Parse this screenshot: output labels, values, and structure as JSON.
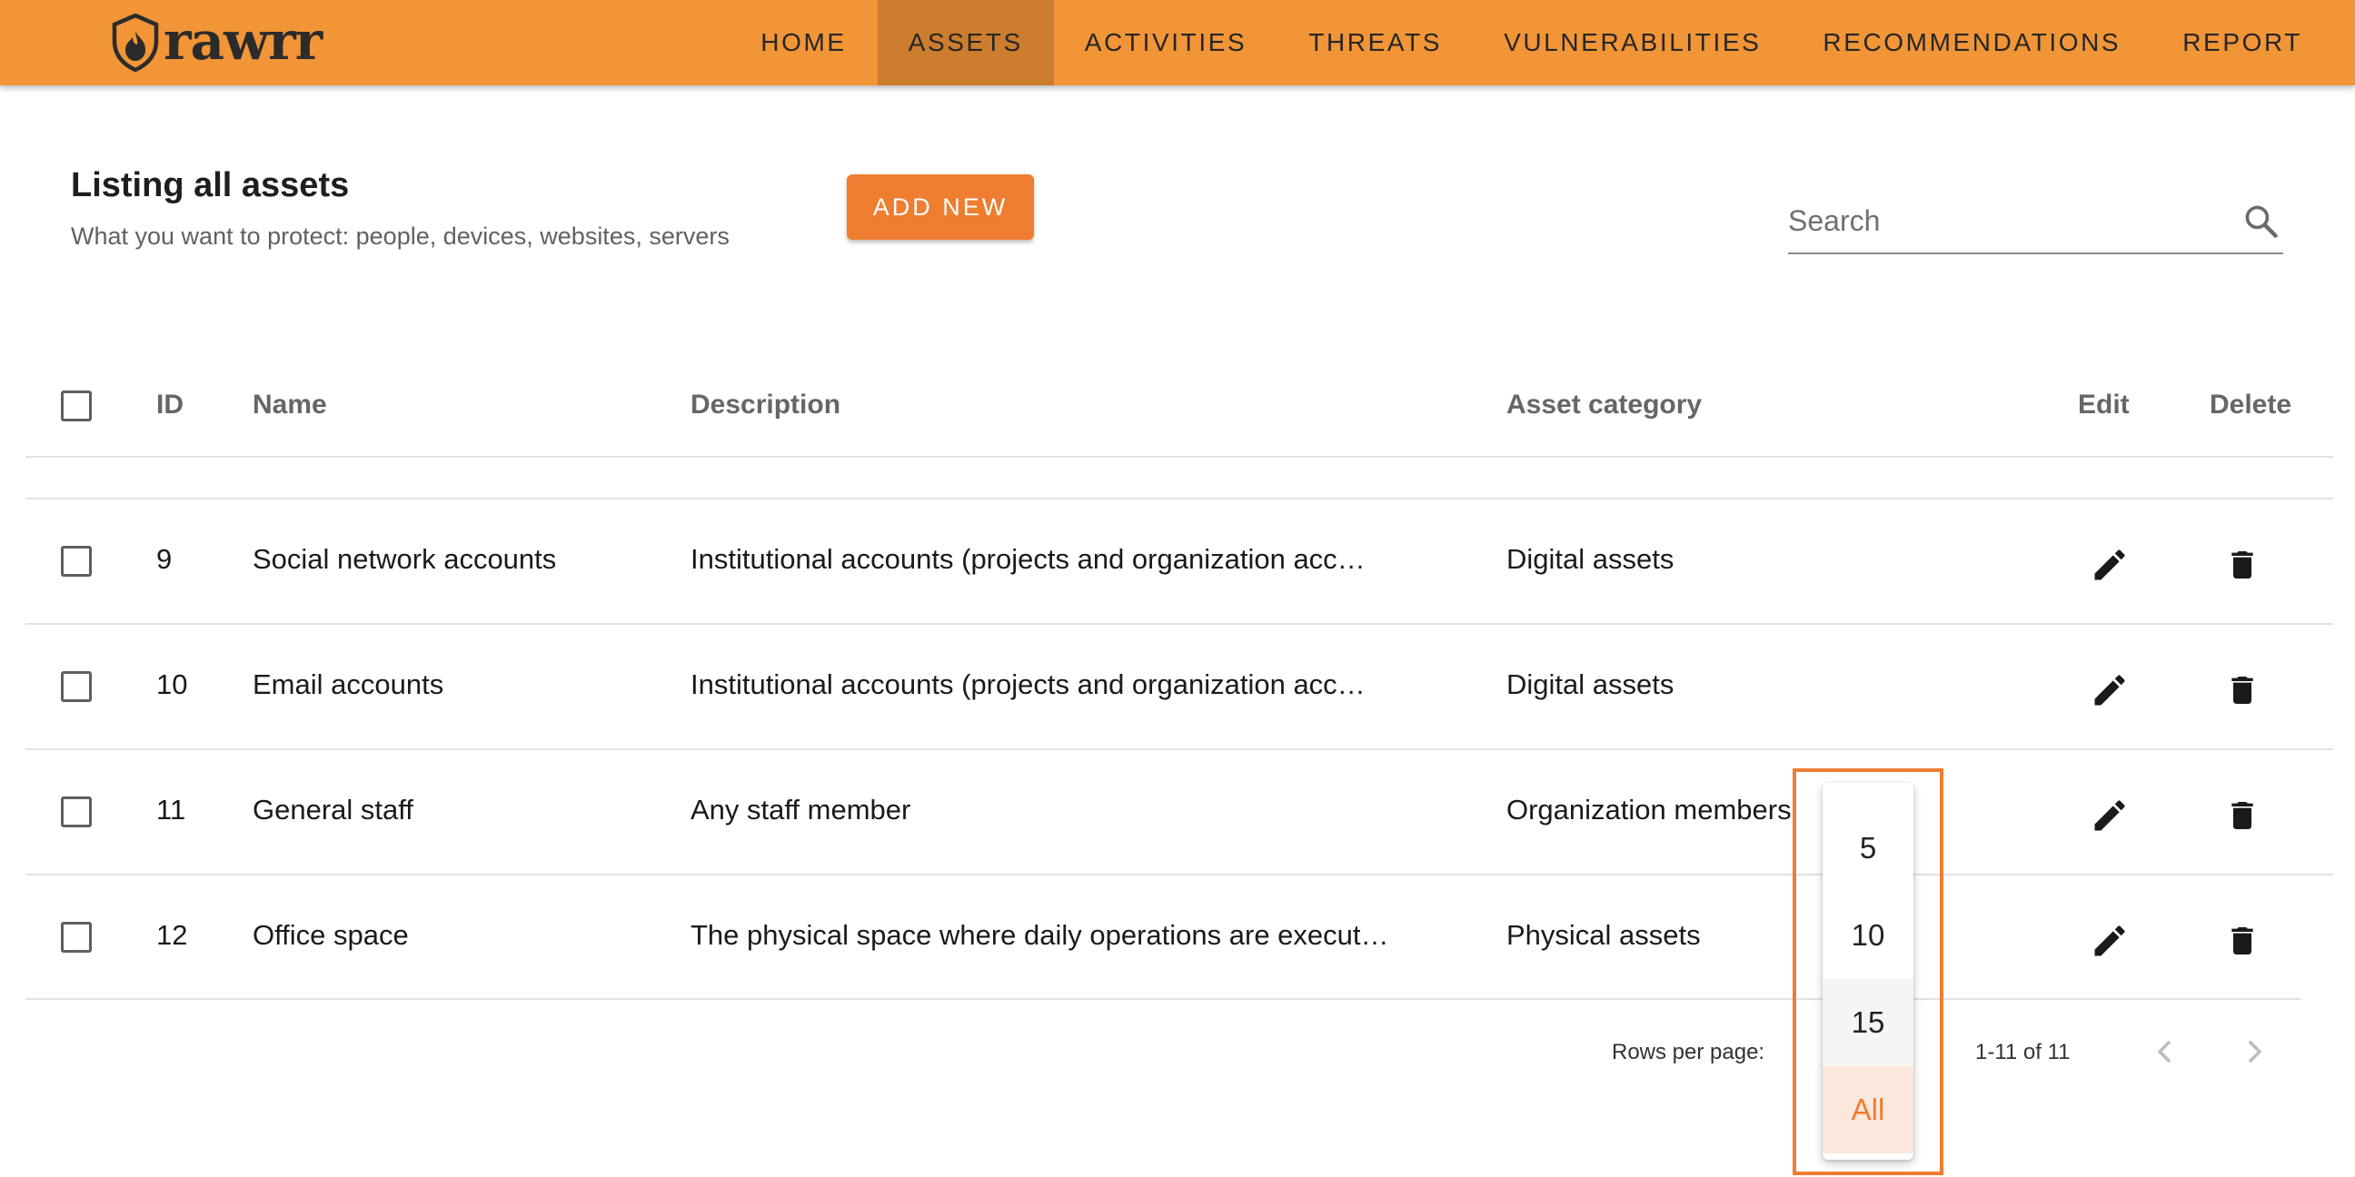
{
  "app": {
    "logo_text": "rawrr"
  },
  "nav": {
    "items": [
      {
        "label": "HOME"
      },
      {
        "label": "ASSETS",
        "active": true
      },
      {
        "label": "ACTIVITIES"
      },
      {
        "label": "THREATS"
      },
      {
        "label": "VULNERABILITIES"
      },
      {
        "label": "RECOMMENDATIONS"
      },
      {
        "label": "REPORT"
      }
    ]
  },
  "header": {
    "title": "Listing all assets",
    "subtitle": "What you want to protect: people, devices, websites, servers",
    "add_button_label": "ADD NEW"
  },
  "search": {
    "placeholder": "Search",
    "value": ""
  },
  "table": {
    "columns": {
      "id": "ID",
      "name": "Name",
      "description": "Description",
      "category": "Asset category",
      "edit": "Edit",
      "delete": "Delete"
    },
    "rows": [
      {
        "id": "9",
        "name": "Social network accounts",
        "description": "Institutional accounts (projects and organization acc…",
        "category": "Digital assets"
      },
      {
        "id": "10",
        "name": "Email accounts",
        "description": "Institutional accounts (projects and organization acc…",
        "category": "Digital assets"
      },
      {
        "id": "11",
        "name": "General staff",
        "description": "Any staff member",
        "category": "Organization members"
      },
      {
        "id": "12",
        "name": "Office space",
        "description": "The physical space where daily operations are execut…",
        "category": "Physical assets"
      }
    ]
  },
  "pagination": {
    "rows_per_page_label": "Rows per page:",
    "range_text": "1-11 of 11",
    "options": [
      "5",
      "10",
      "15",
      "All"
    ],
    "selected": "All",
    "hovered": "15"
  },
  "colors": {
    "navbar": "#f19537",
    "nav_active": "#cc7d2d",
    "accent": "#ee7d30",
    "selected_bg": "#fce7dc"
  },
  "icons": {
    "logo": "shield-flame-icon",
    "search": "search-icon",
    "edit": "pencil-icon",
    "delete": "trash-icon",
    "prev": "chevron-left-icon",
    "next": "chevron-right-icon"
  }
}
